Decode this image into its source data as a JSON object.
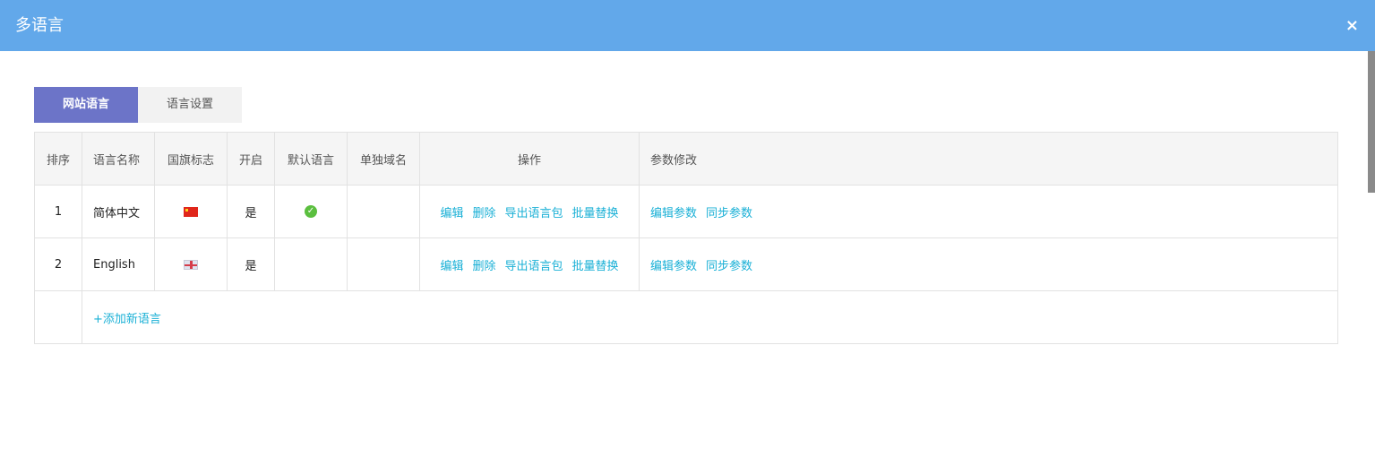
{
  "dialog": {
    "title": "多语言",
    "close_label": "×"
  },
  "tabs": [
    {
      "label": "网站语言",
      "active": true
    },
    {
      "label": "语言设置",
      "active": false
    }
  ],
  "table": {
    "headers": {
      "order": "排序",
      "name": "语言名称",
      "flag": "国旗标志",
      "enabled": "开启",
      "default": "默认语言",
      "domain": "单独域名",
      "actions": "操作",
      "params": "参数修改"
    },
    "rows": [
      {
        "order": "1",
        "name": "简体中文",
        "flag_icon": "china-flag-icon",
        "enabled": "是",
        "is_default": true,
        "domain": "",
        "actions": {
          "edit": "编辑",
          "delete": "删除",
          "export": "导出语言包",
          "replace": "批量替换"
        },
        "params": {
          "edit": "编辑参数",
          "sync": "同步参数"
        }
      },
      {
        "order": "2",
        "name": "English",
        "flag_icon": "uk-flag-icon",
        "enabled": "是",
        "is_default": false,
        "domain": "",
        "actions": {
          "edit": "编辑",
          "delete": "删除",
          "export": "导出语言包",
          "replace": "批量替换"
        },
        "params": {
          "edit": "编辑参数",
          "sync": "同步参数"
        }
      }
    ],
    "add_label": "+添加新语言"
  },
  "colors": {
    "titlebar": "#62a8ea",
    "active_tab": "#6c74c8",
    "link": "#1ab0d6"
  }
}
